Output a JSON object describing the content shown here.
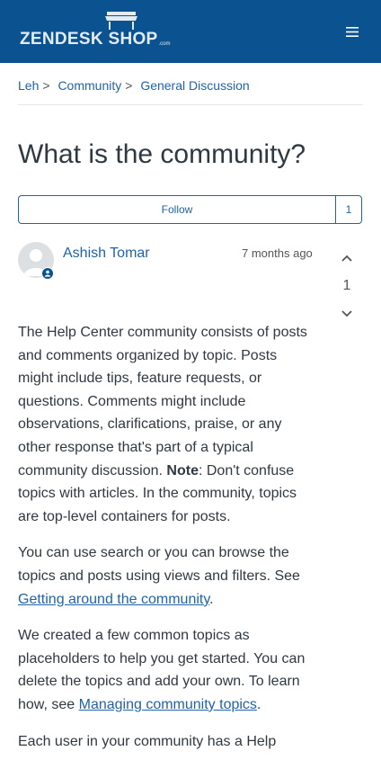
{
  "header": {
    "logo_text": "ZENDESK SHOP",
    "logo_suffix": ".com",
    "menu_icon": "hamburger-icon",
    "brand_color": "#0b5290"
  },
  "breadcrumbs": [
    {
      "label": "Leh"
    },
    {
      "label": "Community"
    },
    {
      "label": "General Discussion"
    }
  ],
  "post": {
    "title": "What is the community?",
    "follow_label": "Follow",
    "follow_count": "1",
    "author_name": "Ashish Tomar",
    "time": "7 months ago",
    "vote_count": "1",
    "paragraphs": {
      "p1_text": "The Help Center community consists of posts and comments organized by topic. Posts might include tips, feature requests, or questions. Comments might include observations, clarifications, praise, or any other response that's part of a typical community discussion.",
      "p1_note_label": "Note",
      "p1_note_text": ": Don't confuse topics with articles. In the community, topics are top-level containers for posts.",
      "p2_text": "You can use search or you can browse the topics and posts using views and filters. See ",
      "p2_link": "Getting around the community",
      "p2_end": ".",
      "p3_text": "We created a few common topics as placeholders to help you get started. You can delete the topics and add your own. To learn how, see ",
      "p3_link": "Managing community topics",
      "p3_end": ".",
      "p4_text": "Each user in your community has a Help"
    }
  },
  "colors": {
    "link": "#1f63a8",
    "text": "#2f3941"
  }
}
